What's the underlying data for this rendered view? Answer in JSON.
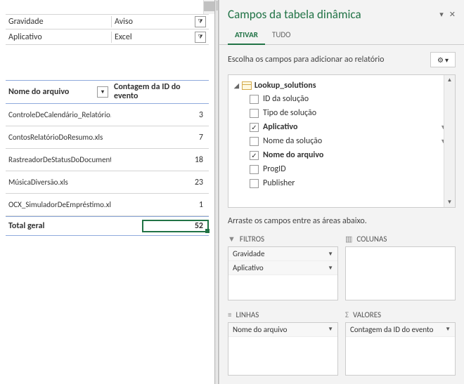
{
  "filters": [
    {
      "label": "Gravidade",
      "value": "Aviso"
    },
    {
      "label": "Aplicativo",
      "value": "Excel"
    }
  ],
  "pivot": {
    "headers": {
      "col1": "Nome do arquivo",
      "col2": "Contagem da ID do evento"
    },
    "rows": [
      {
        "name": "ControleDeCalendário_Relatório.xls",
        "count": 3
      },
      {
        "name": "ContosRelatórioDoResumo.xls",
        "count": 7
      },
      {
        "name": "RastreadorDeStatusDoDocumento.xlsx",
        "count": 18
      },
      {
        "name": "MúsicaDiversão.xls",
        "count": 23
      },
      {
        "name": "OCX_SimuladorDeEmpréstimo.xls",
        "count": 1
      }
    ],
    "total": {
      "label": "Total geral",
      "value": 52
    }
  },
  "pane": {
    "title": "Campos da tabela dinâmica",
    "tabs": {
      "active": "ATIVAR",
      "other": "TUDO"
    },
    "prompt": "Escolha os campos para adicionar ao relatório",
    "table_name": "Lookup_solutions",
    "fields": [
      {
        "label": "ID da solução",
        "checked": false,
        "bold": false,
        "filter": false
      },
      {
        "label": "Tipo de solução",
        "checked": false,
        "bold": false,
        "filter": false
      },
      {
        "label": "Aplicativo",
        "checked": true,
        "bold": true,
        "filter": true
      },
      {
        "label": "Nome da solução",
        "checked": false,
        "bold": false,
        "filter": true
      },
      {
        "label": "Nome do arquivo",
        "checked": true,
        "bold": true,
        "filter": false
      },
      {
        "label": "ProgID",
        "checked": false,
        "bold": false,
        "filter": false
      },
      {
        "label": "Publisher",
        "checked": false,
        "bold": false,
        "filter": false
      }
    ],
    "drag_prompt": "Arraste os campos entre as áreas abaixo.",
    "areas": {
      "filters": {
        "label": "FILTROS",
        "items": [
          "Gravidade",
          "Aplicativo"
        ]
      },
      "columns": {
        "label": "COLUNAS",
        "items": []
      },
      "rows": {
        "label": "LINHAS",
        "items": [
          "Nome do arquivo"
        ]
      },
      "values": {
        "label": "VALORES",
        "items": [
          "Contagem da ID do evento"
        ]
      }
    }
  }
}
